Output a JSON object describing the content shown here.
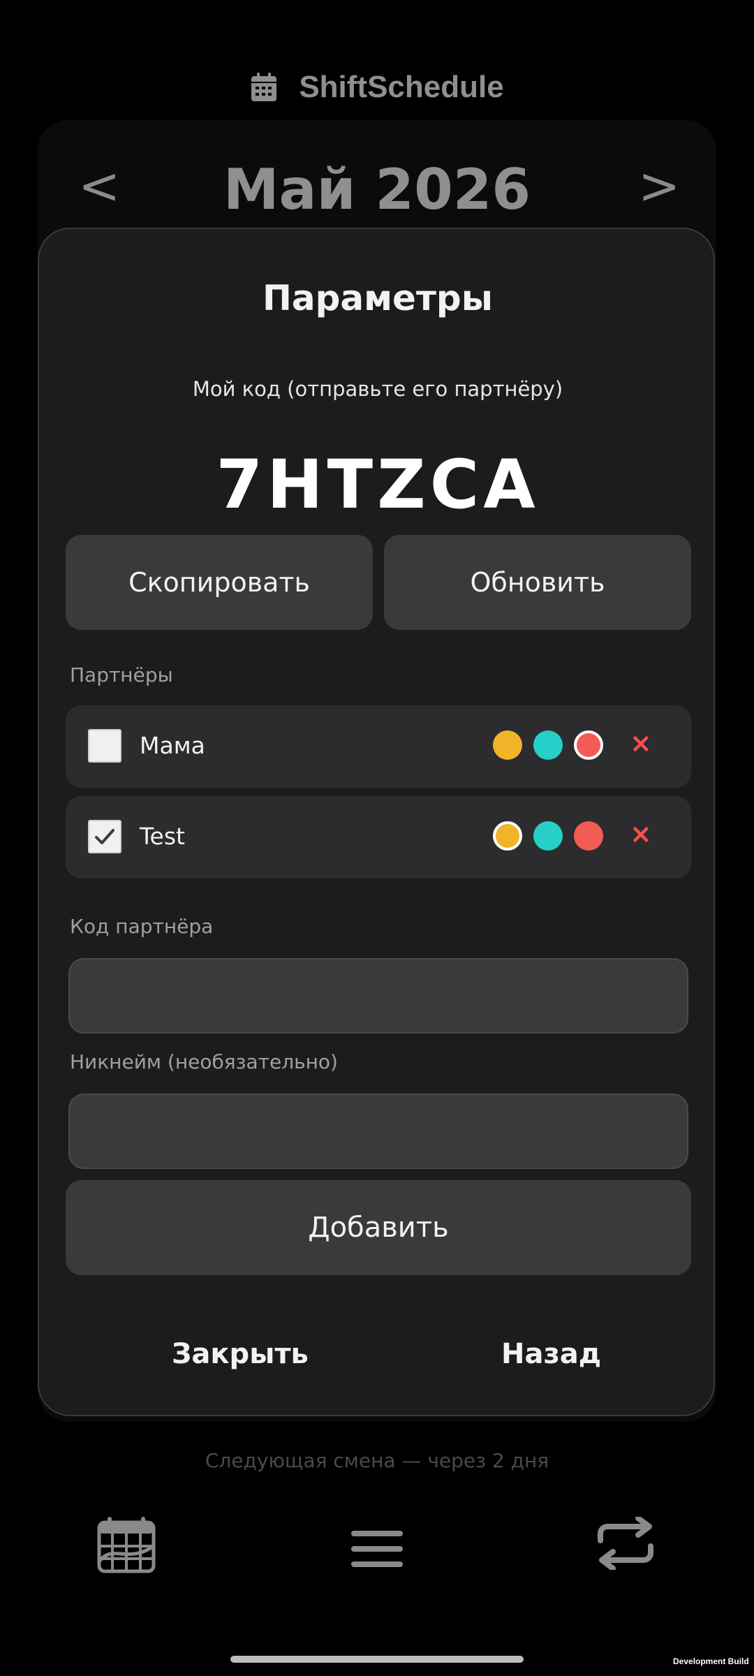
{
  "app": {
    "title": "ShiftSchedule",
    "month": "Май 2026",
    "prev": "<",
    "next": ">",
    "next_shift": "Следующая смена — через 2 дня",
    "dev_build": "Development Build"
  },
  "modal": {
    "title": "Параметры",
    "my_code_label": "Мой код (отправьте его партнёру)",
    "my_code": "7HTZCA",
    "copy_label": "Скопировать",
    "refresh_label": "Обновить",
    "partners_label": "Партнёры",
    "partners": [
      {
        "name": "Мама",
        "checked": false,
        "selected_color": 2
      },
      {
        "name": "Test",
        "checked": true,
        "selected_color": 0
      }
    ],
    "color_options": [
      "#f0b429",
      "#26d0c8",
      "#f25c54"
    ],
    "remove_symbol": "×",
    "partner_code_label": "Код партнёра",
    "partner_code_value": "",
    "nickname_label": "Никнейм (необязательно)",
    "nickname_value": "",
    "add_label": "Добавить",
    "close_label": "Закрыть",
    "back_label": "Назад"
  },
  "nav": {
    "items": [
      "calendar-icon",
      "menu-icon",
      "sync-icon"
    ]
  }
}
